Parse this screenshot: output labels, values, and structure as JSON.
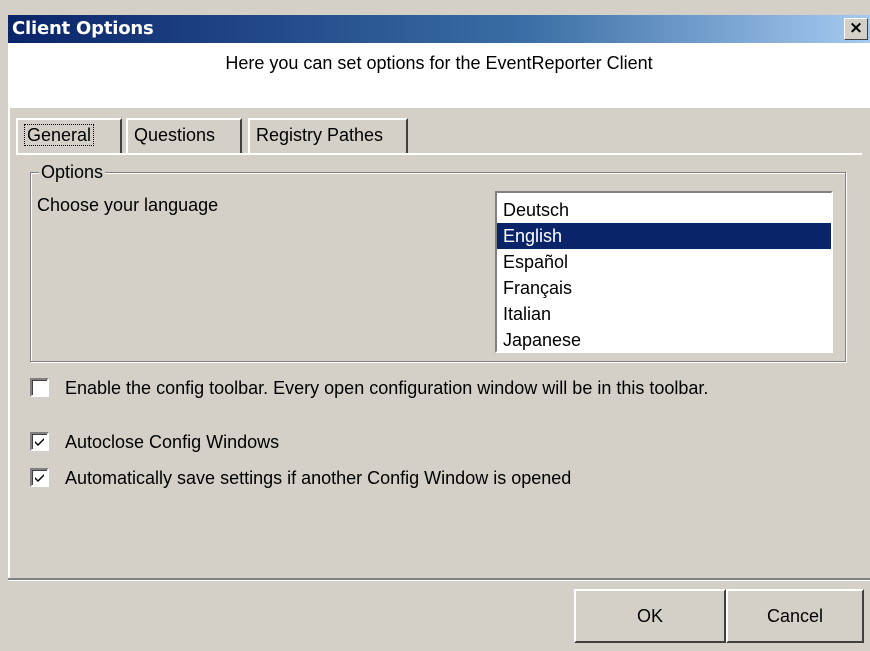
{
  "window": {
    "title": "Client Options",
    "close_glyph": "×"
  },
  "header": {
    "text": "Here you can set options for the EventReporter Client"
  },
  "tabs": [
    {
      "label": "General",
      "active": true
    },
    {
      "label": "Questions",
      "active": false
    },
    {
      "label": "Registry Pathes",
      "active": false
    }
  ],
  "options_group": {
    "title": "Options",
    "language_label": "Choose your language",
    "languages": [
      "Deutsch",
      "English",
      "Español",
      "Français",
      "Italian",
      "Japanese"
    ],
    "selected_language": "English"
  },
  "checkboxes": {
    "config_toolbar": {
      "label": "Enable the config toolbar. Every open configuration window will be in this toolbar.",
      "checked": false
    },
    "autoclose": {
      "label": "Autoclose Config Windows",
      "checked": true
    },
    "autosave": {
      "label": "Automatically save settings if another Config Window is opened",
      "checked": true
    }
  },
  "buttons": {
    "ok": "OK",
    "cancel": "Cancel"
  },
  "colors": {
    "titlebar_start": "#0a246a",
    "titlebar_end": "#a6caf0",
    "selection": "#0a246a",
    "dialog_face": "#d4d0c8"
  }
}
